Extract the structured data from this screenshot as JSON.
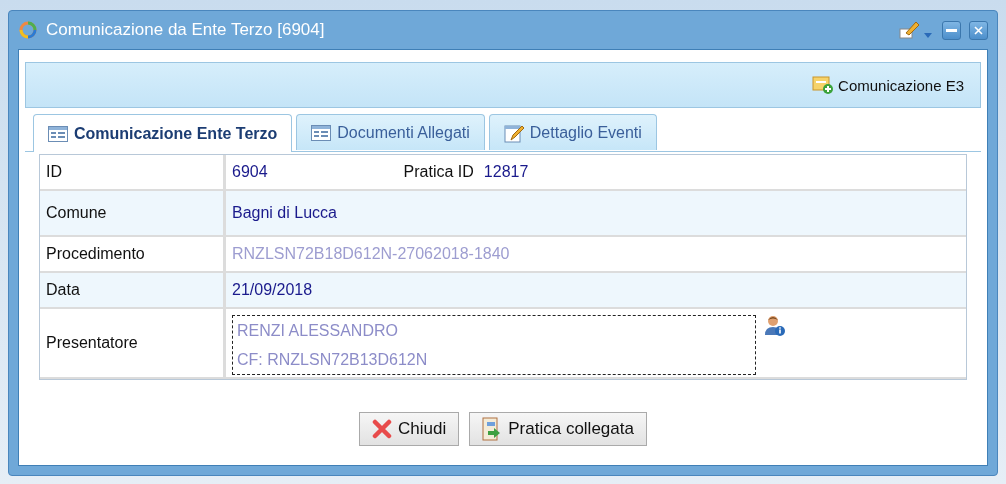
{
  "window": {
    "title": "Comunicazione da Ente Terzo [6904]"
  },
  "toolbar": {
    "button": "Comunicazione E3"
  },
  "tabs": [
    {
      "label": "Comunicazione Ente Terzo",
      "selected": true,
      "kind": "list"
    },
    {
      "label": "Documenti Allegati",
      "selected": false,
      "kind": "list"
    },
    {
      "label": "Dettaglio Eventi",
      "selected": false,
      "kind": "edit"
    }
  ],
  "form": {
    "rows": [
      {
        "label": "ID",
        "kind": "id",
        "value": "6904",
        "extra_label": "Pratica ID",
        "extra_value": "12817"
      },
      {
        "label": "Comune",
        "kind": "text",
        "value": "Bagni di Lucca"
      },
      {
        "label": "Procedimento",
        "kind": "faded",
        "value": "RNZLSN72B18D612N-27062018-1840"
      },
      {
        "label": "Data",
        "kind": "text",
        "value": "21/09/2018"
      },
      {
        "label": "Presentatore",
        "kind": "person",
        "lines": [
          "RENZI ALESSANDRO",
          "CF: RNZLSN72B13D612N"
        ]
      }
    ]
  },
  "buttons": [
    {
      "label": "Chiudi",
      "kind": "close"
    },
    {
      "label": "Pratica collegata",
      "kind": "link"
    }
  ]
}
